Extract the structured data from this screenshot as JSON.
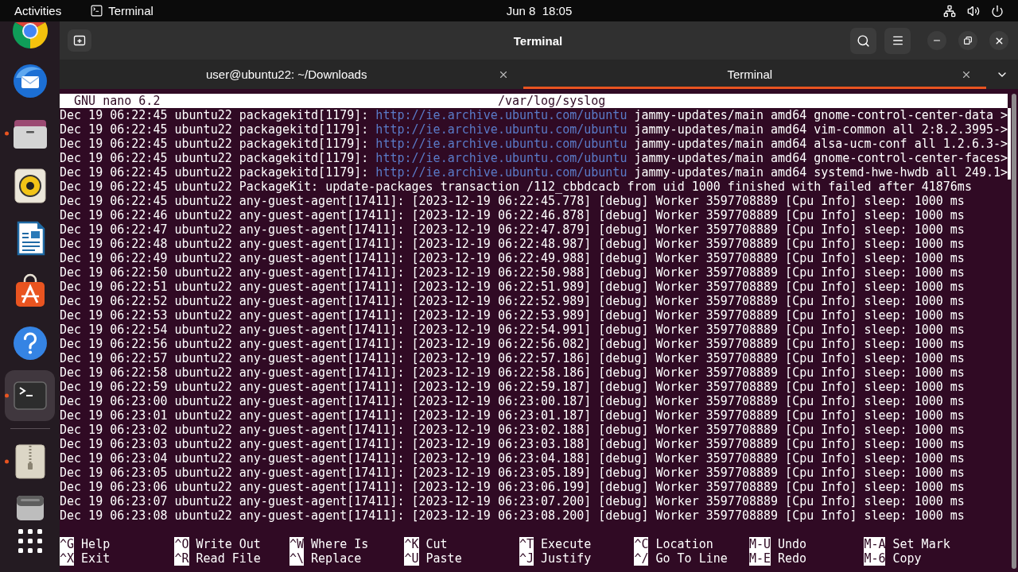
{
  "top_bar": {
    "activities": "Activities",
    "app_menu": "Terminal",
    "clock": "Jun 8  18:05"
  },
  "dock": {
    "scrolled": true,
    "favorites": [
      {
        "kind": "browser",
        "selected": false,
        "running": false
      },
      {
        "kind": "mail",
        "selected": false,
        "running": false
      },
      {
        "kind": "files",
        "selected": false,
        "running": true
      },
      {
        "kind": "music",
        "selected": false,
        "running": false
      },
      {
        "kind": "writer",
        "selected": false,
        "running": false
      },
      {
        "kind": "store",
        "selected": false,
        "running": false
      },
      {
        "kind": "help",
        "selected": false,
        "running": false
      },
      {
        "kind": "terminal",
        "selected": true,
        "running": true
      }
    ],
    "others": [
      {
        "kind": "archive",
        "selected": false,
        "running": true
      },
      {
        "kind": "drive",
        "selected": false,
        "running": false
      }
    ]
  },
  "window": {
    "title": "Terminal"
  },
  "tabs": [
    {
      "label": "user@ubuntu22: ~/Downloads",
      "selected": false
    },
    {
      "label": "Terminal",
      "selected": true
    }
  ],
  "nano": {
    "version": "GNU nano 6.2",
    "file": "/var/log/syslog",
    "lines": [
      {
        "kind": "url",
        "prefix": "Dec 19 06:22:45 ubuntu22 packagekitd[1179]: ",
        "url": "http://ie.archive.ubuntu.com/ubuntu",
        "rest": " jammy-updates/main amd64 gnome-control-center-data",
        "marker": ">"
      },
      {
        "kind": "url",
        "prefix": "Dec 19 06:22:45 ubuntu22 packagekitd[1179]: ",
        "url": "http://ie.archive.ubuntu.com/ubuntu",
        "rest": " jammy-updates/main amd64 vim-common all 2:8.2.3995-",
        "marker": ">"
      },
      {
        "kind": "url",
        "prefix": "Dec 19 06:22:45 ubuntu22 packagekitd[1179]: ",
        "url": "http://ie.archive.ubuntu.com/ubuntu",
        "rest": " jammy-updates/main amd64 alsa-ucm-conf all 1.2.6.3-",
        "marker": ">"
      },
      {
        "kind": "url",
        "prefix": "Dec 19 06:22:45 ubuntu22 packagekitd[1179]: ",
        "url": "http://ie.archive.ubuntu.com/ubuntu",
        "rest": " jammy-updates/main amd64 gnome-control-center-faces",
        "marker": ">"
      },
      {
        "kind": "url",
        "prefix": "Dec 19 06:22:45 ubuntu22 packagekitd[1179]: ",
        "url": "http://ie.archive.ubuntu.com/ubuntu",
        "rest": " jammy-updates/main amd64 systemd-hwe-hwdb all 249.1",
        "marker": ">"
      },
      {
        "kind": "plain",
        "text": "Dec 19 06:22:45 ubuntu22 PackageKit: update-packages transaction /112_cbbdcacb from uid 1000 finished with failed after 41876ms"
      },
      {
        "kind": "plain",
        "text": "Dec 19 06:22:45 ubuntu22 any-guest-agent[17411]: [2023-12-19 06:22:45.778] [debug] Worker 3597708889 [Cpu Info] sleep: 1000 ms"
      },
      {
        "kind": "plain",
        "text": "Dec 19 06:22:46 ubuntu22 any-guest-agent[17411]: [2023-12-19 06:22:46.878] [debug] Worker 3597708889 [Cpu Info] sleep: 1000 ms"
      },
      {
        "kind": "plain",
        "text": "Dec 19 06:22:47 ubuntu22 any-guest-agent[17411]: [2023-12-19 06:22:47.879] [debug] Worker 3597708889 [Cpu Info] sleep: 1000 ms"
      },
      {
        "kind": "plain",
        "text": "Dec 19 06:22:48 ubuntu22 any-guest-agent[17411]: [2023-12-19 06:22:48.987] [debug] Worker 3597708889 [Cpu Info] sleep: 1000 ms"
      },
      {
        "kind": "plain",
        "text": "Dec 19 06:22:49 ubuntu22 any-guest-agent[17411]: [2023-12-19 06:22:49.988] [debug] Worker 3597708889 [Cpu Info] sleep: 1000 ms"
      },
      {
        "kind": "plain",
        "text": "Dec 19 06:22:50 ubuntu22 any-guest-agent[17411]: [2023-12-19 06:22:50.988] [debug] Worker 3597708889 [Cpu Info] sleep: 1000 ms"
      },
      {
        "kind": "plain",
        "text": "Dec 19 06:22:51 ubuntu22 any-guest-agent[17411]: [2023-12-19 06:22:51.989] [debug] Worker 3597708889 [Cpu Info] sleep: 1000 ms"
      },
      {
        "kind": "plain",
        "text": "Dec 19 06:22:52 ubuntu22 any-guest-agent[17411]: [2023-12-19 06:22:52.989] [debug] Worker 3597708889 [Cpu Info] sleep: 1000 ms"
      },
      {
        "kind": "plain",
        "text": "Dec 19 06:22:53 ubuntu22 any-guest-agent[17411]: [2023-12-19 06:22:53.989] [debug] Worker 3597708889 [Cpu Info] sleep: 1000 ms"
      },
      {
        "kind": "plain",
        "text": "Dec 19 06:22:54 ubuntu22 any-guest-agent[17411]: [2023-12-19 06:22:54.991] [debug] Worker 3597708889 [Cpu Info] sleep: 1000 ms"
      },
      {
        "kind": "plain",
        "text": "Dec 19 06:22:56 ubuntu22 any-guest-agent[17411]: [2023-12-19 06:22:56.082] [debug] Worker 3597708889 [Cpu Info] sleep: 1000 ms"
      },
      {
        "kind": "plain",
        "text": "Dec 19 06:22:57 ubuntu22 any-guest-agent[17411]: [2023-12-19 06:22:57.186] [debug] Worker 3597708889 [Cpu Info] sleep: 1000 ms"
      },
      {
        "kind": "plain",
        "text": "Dec 19 06:22:58 ubuntu22 any-guest-agent[17411]: [2023-12-19 06:22:58.186] [debug] Worker 3597708889 [Cpu Info] sleep: 1000 ms"
      },
      {
        "kind": "plain",
        "text": "Dec 19 06:22:59 ubuntu22 any-guest-agent[17411]: [2023-12-19 06:22:59.187] [debug] Worker 3597708889 [Cpu Info] sleep: 1000 ms"
      },
      {
        "kind": "plain",
        "text": "Dec 19 06:23:00 ubuntu22 any-guest-agent[17411]: [2023-12-19 06:23:00.187] [debug] Worker 3597708889 [Cpu Info] sleep: 1000 ms"
      },
      {
        "kind": "plain",
        "text": "Dec 19 06:23:01 ubuntu22 any-guest-agent[17411]: [2023-12-19 06:23:01.187] [debug] Worker 3597708889 [Cpu Info] sleep: 1000 ms"
      },
      {
        "kind": "plain",
        "text": "Dec 19 06:23:02 ubuntu22 any-guest-agent[17411]: [2023-12-19 06:23:02.188] [debug] Worker 3597708889 [Cpu Info] sleep: 1000 ms"
      },
      {
        "kind": "plain",
        "text": "Dec 19 06:23:03 ubuntu22 any-guest-agent[17411]: [2023-12-19 06:23:03.188] [debug] Worker 3597708889 [Cpu Info] sleep: 1000 ms"
      },
      {
        "kind": "plain",
        "text": "Dec 19 06:23:04 ubuntu22 any-guest-agent[17411]: [2023-12-19 06:23:04.188] [debug] Worker 3597708889 [Cpu Info] sleep: 1000 ms"
      },
      {
        "kind": "plain",
        "text": "Dec 19 06:23:05 ubuntu22 any-guest-agent[17411]: [2023-12-19 06:23:05.189] [debug] Worker 3597708889 [Cpu Info] sleep: 1000 ms"
      },
      {
        "kind": "plain",
        "text": "Dec 19 06:23:06 ubuntu22 any-guest-agent[17411]: [2023-12-19 06:23:06.199] [debug] Worker 3597708889 [Cpu Info] sleep: 1000 ms"
      },
      {
        "kind": "plain",
        "text": "Dec 19 06:23:07 ubuntu22 any-guest-agent[17411]: [2023-12-19 06:23:07.200] [debug] Worker 3597708889 [Cpu Info] sleep: 1000 ms"
      },
      {
        "kind": "plain",
        "text": "Dec 19 06:23:08 ubuntu22 any-guest-agent[17411]: [2023-12-19 06:23:08.200] [debug] Worker 3597708889 [Cpu Info] sleep: 1000 ms"
      }
    ],
    "shortcut_rows": [
      [
        {
          "key": "^G",
          "label": "Help"
        },
        {
          "key": "^O",
          "label": "Write Out"
        },
        {
          "key": "^W",
          "label": "Where Is"
        },
        {
          "key": "^K",
          "label": "Cut"
        },
        {
          "key": "^T",
          "label": "Execute"
        },
        {
          "key": "^C",
          "label": "Location"
        },
        {
          "key": "M-U",
          "label": "Undo"
        },
        {
          "key": "M-A",
          "label": "Set Mark"
        }
      ],
      [
        {
          "key": "^X",
          "label": "Exit"
        },
        {
          "key": "^R",
          "label": "Read File"
        },
        {
          "key": "^\\",
          "label": "Replace"
        },
        {
          "key": "^U",
          "label": "Paste"
        },
        {
          "key": "^J",
          "label": "Justify"
        },
        {
          "key": "^/",
          "label": "Go To Line"
        },
        {
          "key": "M-E",
          "label": "Redo"
        },
        {
          "key": "M-6",
          "label": "Copy"
        }
      ]
    ]
  }
}
